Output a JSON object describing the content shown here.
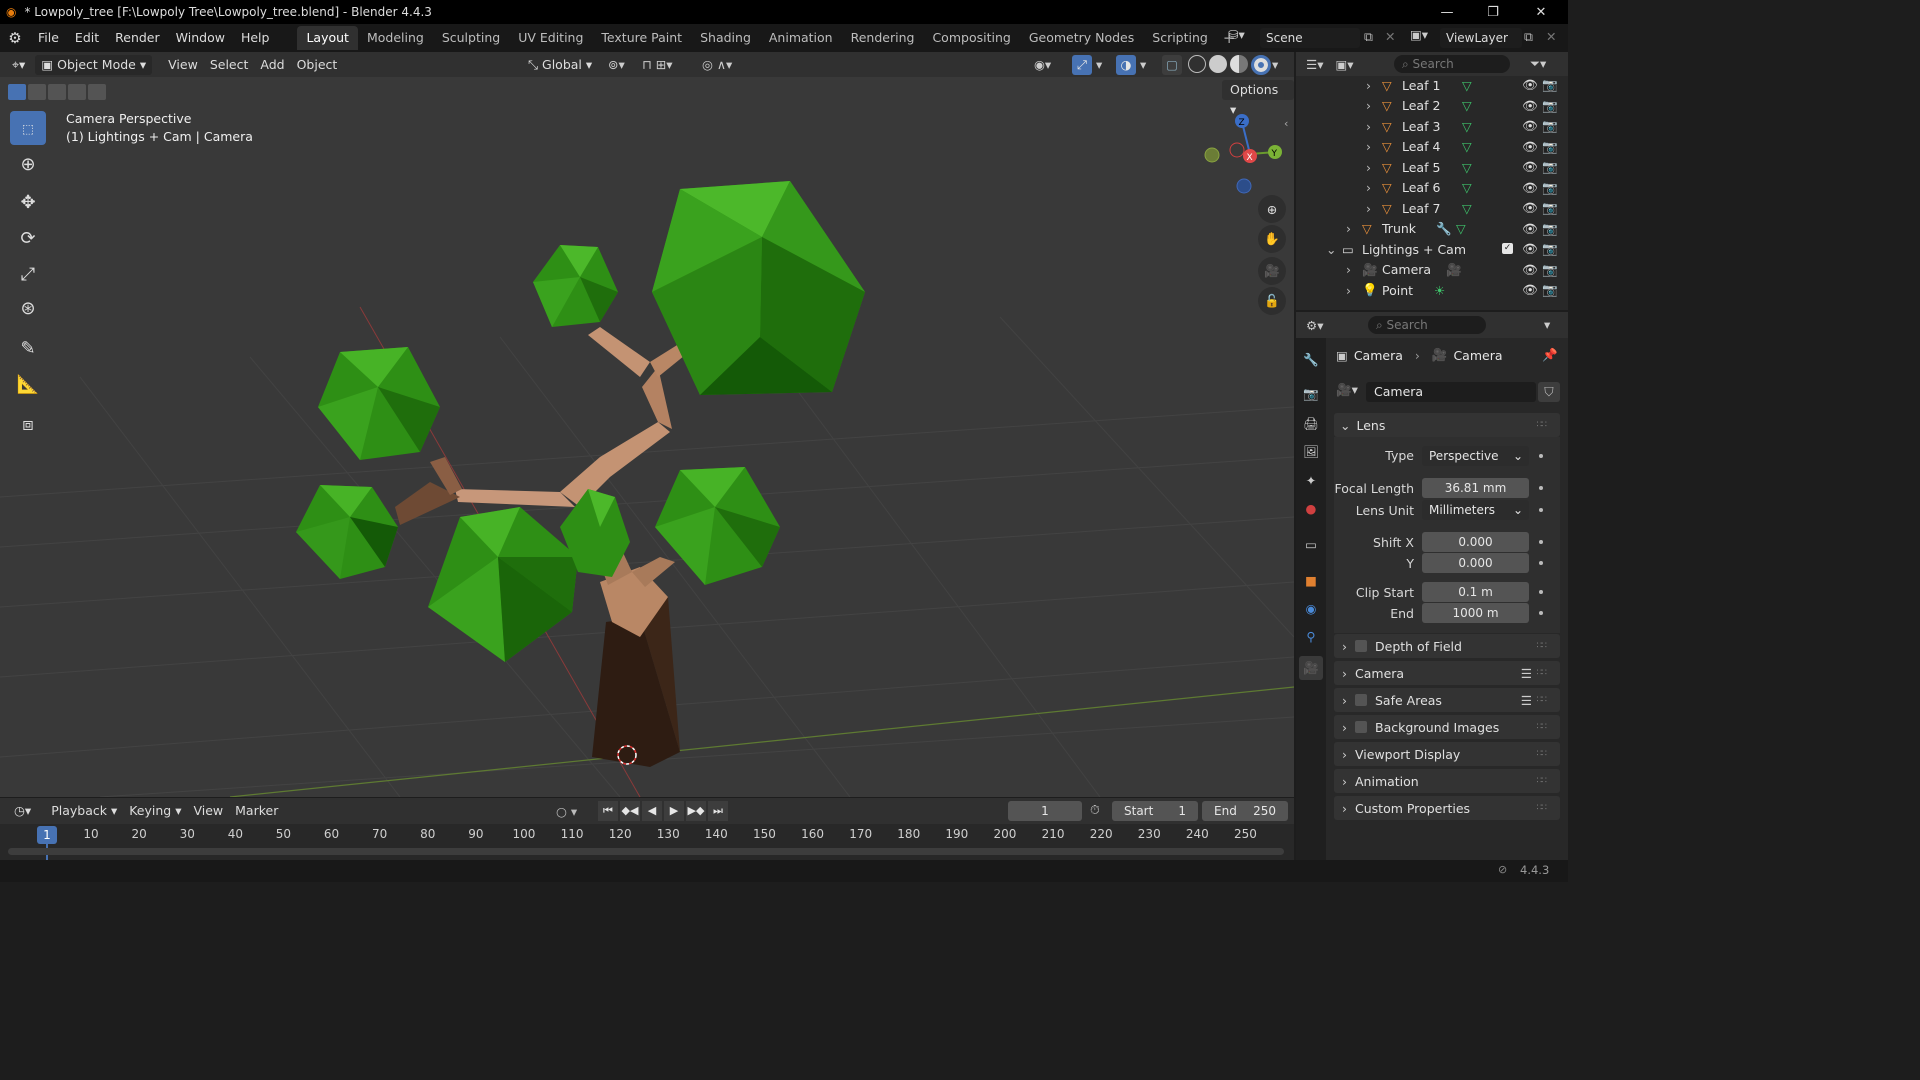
{
  "titlebar": {
    "title": "* Lowpoly_tree [F:\\Lowpoly Tree\\Lowpoly_tree.blend] - Blender 4.4.3"
  },
  "menu": {
    "items": [
      "File",
      "Edit",
      "Render",
      "Window",
      "Help"
    ]
  },
  "workspaces": [
    "Layout",
    "Modeling",
    "Sculpting",
    "UV Editing",
    "Texture Paint",
    "Shading",
    "Animation",
    "Rendering",
    "Compositing",
    "Geometry Nodes",
    "Scripting"
  ],
  "scene": {
    "name": "Scene",
    "view_layer": "ViewLayer"
  },
  "viewport_header": {
    "mode": "Object Mode",
    "menus": [
      "View",
      "Select",
      "Add",
      "Object"
    ],
    "orientation": "Global",
    "options": "Options"
  },
  "viewport": {
    "line1": "Camera Perspective",
    "line2": "(1) Lightings + Cam | Camera"
  },
  "outliner": {
    "search_placeholder": "Search",
    "rows": [
      {
        "name": "Leaf 1"
      },
      {
        "name": "Leaf 2"
      },
      {
        "name": "Leaf 3"
      },
      {
        "name": "Leaf 4"
      },
      {
        "name": "Leaf 5"
      },
      {
        "name": "Leaf 6"
      },
      {
        "name": "Leaf 7"
      },
      {
        "name": "Trunk"
      },
      {
        "name": "Lightings + Cam"
      },
      {
        "name": "Camera"
      },
      {
        "name": "Point"
      }
    ]
  },
  "properties": {
    "search_placeholder": "Search",
    "breadcrumb_object": "Camera",
    "breadcrumb_data": "Camera",
    "datablock": "Camera",
    "lens": {
      "title": "Lens",
      "type_label": "Type",
      "type_value": "Perspective",
      "focal_label": "Focal Length",
      "focal_value": "36.81 mm",
      "unit_label": "Lens Unit",
      "unit_value": "Millimeters",
      "shiftx_label": "Shift X",
      "shiftx_value": "0.000",
      "shifty_label": "Y",
      "shifty_value": "0.000",
      "clipstart_label": "Clip Start",
      "clipstart_value": "0.1 m",
      "clipend_label": "End",
      "clipend_value": "1000 m"
    },
    "panels": [
      "Depth of Field",
      "Camera",
      "Safe Areas",
      "Background Images",
      "Viewport Display",
      "Animation",
      "Custom Properties"
    ]
  },
  "timeline": {
    "menus": [
      "Playback",
      "Keying",
      "View",
      "Marker"
    ],
    "current_frame": "1",
    "start_label": "Start",
    "start_value": "1",
    "end_label": "End",
    "end_value": "250",
    "ruler": [
      "10",
      "20",
      "30",
      "40",
      "50",
      "60",
      "70",
      "80",
      "90",
      "100",
      "110",
      "120",
      "130",
      "140",
      "150",
      "160",
      "170",
      "180",
      "190",
      "200",
      "210",
      "220",
      "230",
      "240",
      "250"
    ],
    "cursor": "1"
  },
  "status": {
    "version": "4.4.3"
  },
  "colors": {
    "accent": "#4772b3",
    "leaf": "#2f9a16",
    "trunk": "#b98765",
    "panel": "#303030"
  }
}
